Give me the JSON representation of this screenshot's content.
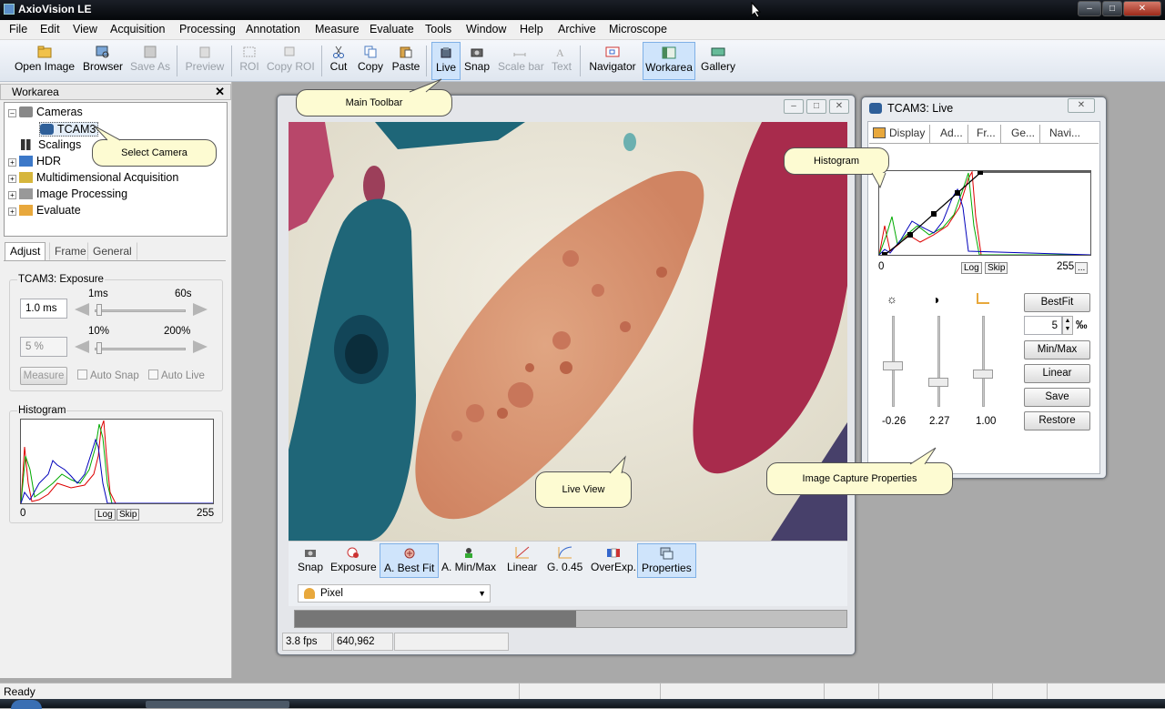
{
  "app": {
    "title": "AxioVision LE"
  },
  "menu": [
    "File",
    "Edit",
    "View",
    "Acquisition",
    "Processing",
    "Annotation",
    "Measure",
    "Evaluate",
    "Tools",
    "Window",
    "Help",
    "Archive",
    "Microscope"
  ],
  "toolbar": {
    "open_image": "Open Image",
    "browser": "Browser",
    "save_as": "Save As",
    "preview": "Preview",
    "roi": "ROI",
    "copy_roi": "Copy ROI",
    "cut": "Cut",
    "copy": "Copy",
    "paste": "Paste",
    "live": "Live",
    "snap": "Snap",
    "scale_bar": "Scale bar",
    "text": "Text",
    "navigator": "Navigator",
    "workarea": "Workarea",
    "gallery": "Gallery"
  },
  "workarea": {
    "title": "Workarea",
    "tree": {
      "cameras": "Cameras",
      "tcam3": "TCAM3",
      "scalings": "Scalings",
      "hdr": "HDR",
      "multidim": "Multidimensional Acquisition",
      "image_processing": "Image Processing",
      "evaluate": "Evaluate"
    },
    "tabs": {
      "adjust": "Adjust",
      "frame": "Frame",
      "general": "General"
    },
    "exposure": {
      "group": "TCAM3: Exposure",
      "value": "1.0 ms",
      "min": "1ms",
      "max": "60s",
      "gain_value": "5 %",
      "gain_min": "10%",
      "gain_max": "200%",
      "measure": "Measure",
      "auto_snap": "Auto Snap",
      "auto_live": "Auto Live"
    },
    "histogram": {
      "label": "Histogram",
      "min": "0",
      "max": "255",
      "log": "Log",
      "skip": "Skip"
    }
  },
  "live_window": {
    "bottom_toolbar": {
      "snap": "Snap",
      "exposure": "Exposure",
      "best_fit": "A. Best Fit",
      "min_max": "A. Min/Max",
      "linear": "Linear",
      "gamma": "G. 0.45",
      "overexp": "OverExp.",
      "properties": "Properties"
    },
    "pixel_select": "Pixel",
    "progress": 0.51,
    "status": {
      "fps": "3.8 fps",
      "coords": "640,962"
    }
  },
  "display_window": {
    "title": "TCAM3: Live",
    "tabs": {
      "display": "Display",
      "adjust": "Ad...",
      "frame": "Fr...",
      "general": "Ge...",
      "navigator": "Navi..."
    },
    "hist_min": "0",
    "hist_max": "255",
    "log": "Log",
    "skip": "Skip",
    "more": "...",
    "brightness": "-0.26",
    "contrast": "2.27",
    "gamma": "1.00",
    "buttons": {
      "bestfit": "BestFit",
      "minmax": "Min/Max",
      "linear": "Linear",
      "save": "Save",
      "restore": "Restore"
    },
    "percent_value": "5",
    "permille": "‰"
  },
  "callouts": {
    "main_toolbar": "Main Toolbar",
    "select_camera": "Select Camera",
    "histogram": "Histogram",
    "live_view": "Live View",
    "capture_props": "Image Capture Properties"
  },
  "statusbar": {
    "text": "Ready"
  },
  "colors": {
    "highlight": "#cfe4fb",
    "callout": "#fdfbd2",
    "titlebar": "#0d1117"
  }
}
